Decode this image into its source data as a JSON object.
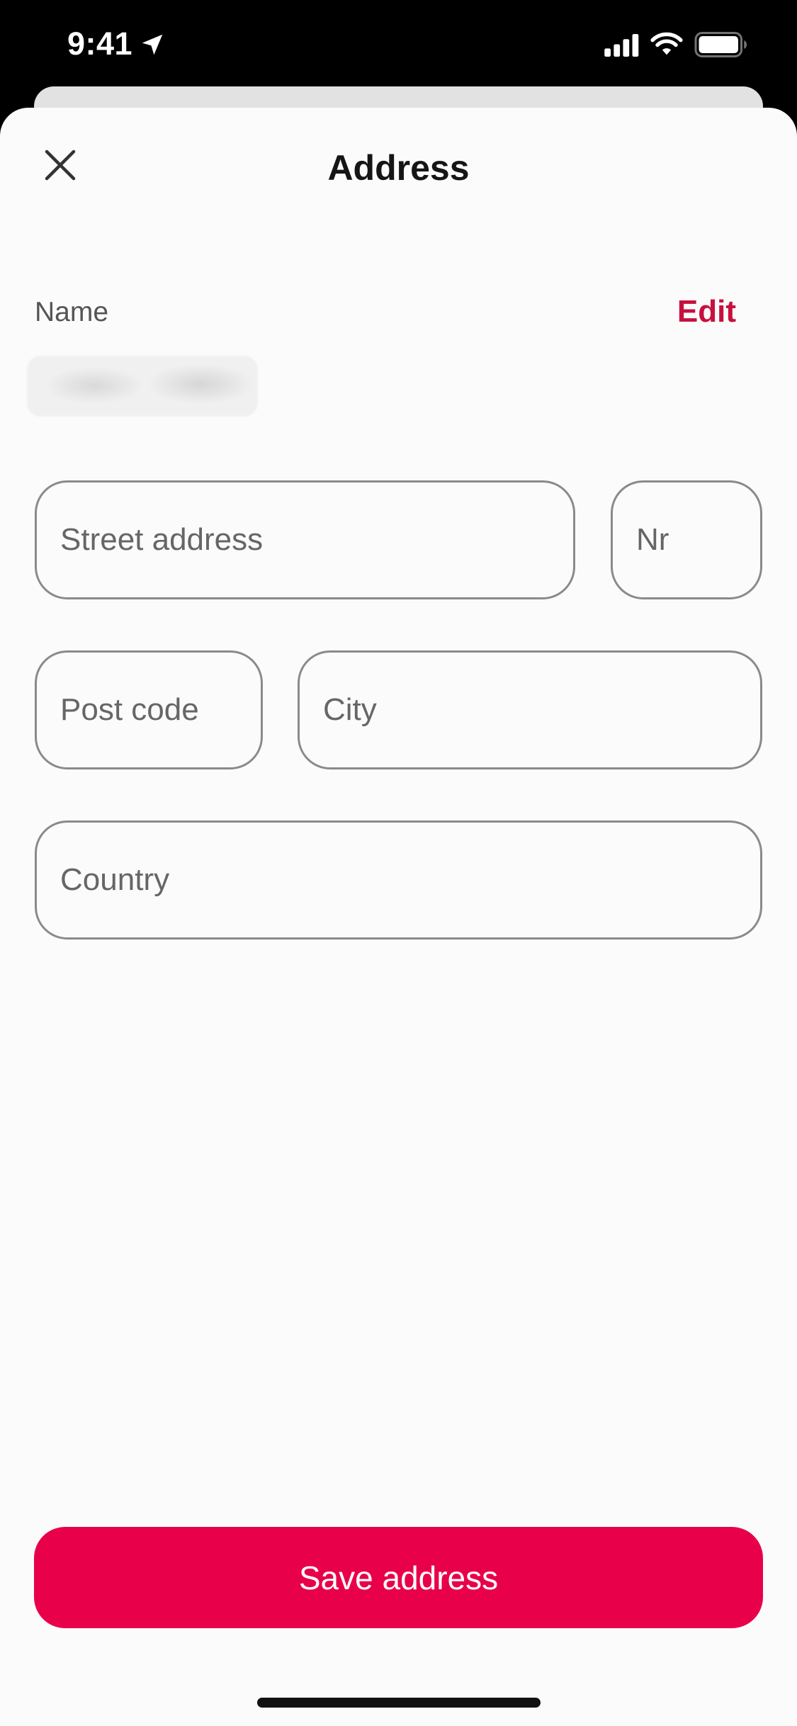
{
  "status_bar": {
    "time": "9:41",
    "icons": [
      "location-arrow-icon",
      "cellular-signal-icon",
      "wifi-icon",
      "battery-icon"
    ]
  },
  "header": {
    "title": "Address",
    "close_icon": "close-icon"
  },
  "name_section": {
    "label": "Name",
    "edit_label": "Edit",
    "value_redacted": true
  },
  "form": {
    "street_placeholder": "Street address",
    "nr_placeholder": "Nr",
    "post_code_placeholder": "Post code",
    "city_placeholder": "City",
    "country_placeholder": "Country"
  },
  "actions": {
    "save_label": "Save address"
  },
  "colors": {
    "accent": "#e8004a",
    "edit_link": "#c8103f",
    "sheet_background": "#fbfbfb",
    "field_border": "#8a8a8a"
  }
}
